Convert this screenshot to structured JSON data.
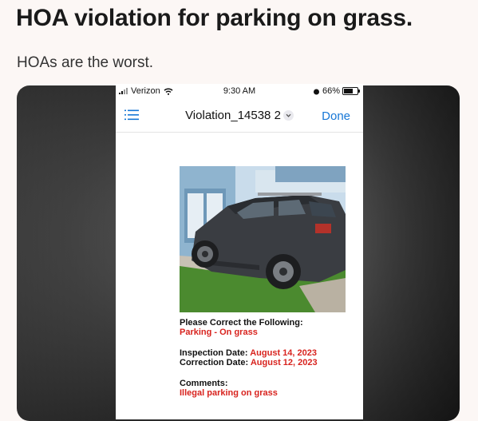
{
  "post": {
    "title": "HOA violation for parking on grass.",
    "subtitle": "HOAs are the worst."
  },
  "phone": {
    "status_bar": {
      "carrier": "Verizon",
      "time": "9:30 AM",
      "battery": "66%"
    },
    "nav": {
      "menu_icon": "list-icon",
      "title": "Violation_14538 2",
      "done_label": "Done"
    },
    "document": {
      "correct_heading": "Please Correct the Following:",
      "violation": "Parking - On grass",
      "inspection_label": "Inspection Date:",
      "inspection_date": "August 14, 2023",
      "correction_label": "Correction Date:",
      "correction_date": "August 12, 2023",
      "comments_label": "Comments:",
      "comments_value": "Illegal parking on grass"
    }
  },
  "colors": {
    "accent_blue": "#1677d6",
    "alert_red": "#d8231e",
    "page_bg": "#fcf7f5"
  }
}
